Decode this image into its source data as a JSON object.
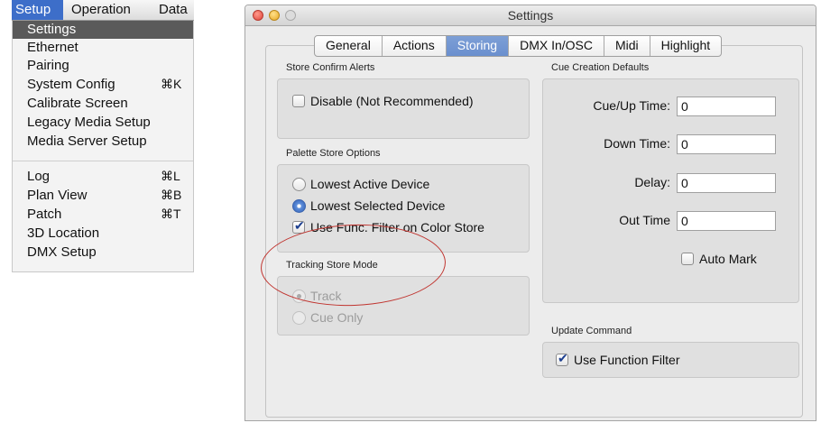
{
  "menu": {
    "bar": {
      "setup": "Setup",
      "operation": "Operation",
      "data": "Data"
    },
    "items": [
      {
        "label": "Settings",
        "shortcut": ""
      },
      {
        "label": "Ethernet",
        "shortcut": ""
      },
      {
        "label": "Pairing",
        "shortcut": ""
      },
      {
        "label": "System Config",
        "shortcut": "⌘K"
      },
      {
        "label": "Calibrate Screen",
        "shortcut": ""
      },
      {
        "label": "Legacy Media Setup",
        "shortcut": ""
      },
      {
        "label": "Media Server Setup",
        "shortcut": ""
      },
      {
        "label": "Log",
        "shortcut": "⌘L"
      },
      {
        "label": "Plan View",
        "shortcut": "⌘B"
      },
      {
        "label": "Patch",
        "shortcut": "⌘T"
      },
      {
        "label": "3D Location",
        "shortcut": ""
      },
      {
        "label": "DMX Setup",
        "shortcut": ""
      }
    ]
  },
  "window": {
    "title": "Settings",
    "tabs": [
      "General",
      "Actions",
      "Storing",
      "DMX In/OSC",
      "Midi",
      "Highlight"
    ],
    "active_tab": "Storing"
  },
  "store_confirm": {
    "title": "Store Confirm Alerts",
    "disable_label": "Disable (Not Recommended)",
    "disable_checked": false
  },
  "palette_store": {
    "title": "Palette Store Options",
    "lowest_active": "Lowest Active Device",
    "lowest_selected": "Lowest Selected Device",
    "use_filter": "Use Func. Filter on Color Store",
    "selected_option": "Lowest Selected Device",
    "use_filter_checked": true
  },
  "tracking_store": {
    "title": "Tracking Store Mode",
    "track": "Track",
    "cue_only": "Cue Only",
    "selected_option": "Track",
    "enabled": false
  },
  "cue_defaults": {
    "title": "Cue Creation Defaults",
    "cue_up_label": "Cue/Up Time:",
    "cue_up_value": "0",
    "down_label": "Down Time:",
    "down_value": "0",
    "delay_label": "Delay:",
    "delay_value": "0",
    "out_label": "Out Time",
    "out_value": "0",
    "auto_mark_label": "Auto Mark",
    "auto_mark_checked": false
  },
  "update_command": {
    "title": "Update Command",
    "use_function_filter": "Use Function Filter",
    "use_function_filter_checked": true
  },
  "annotation_color": "#c0342f"
}
